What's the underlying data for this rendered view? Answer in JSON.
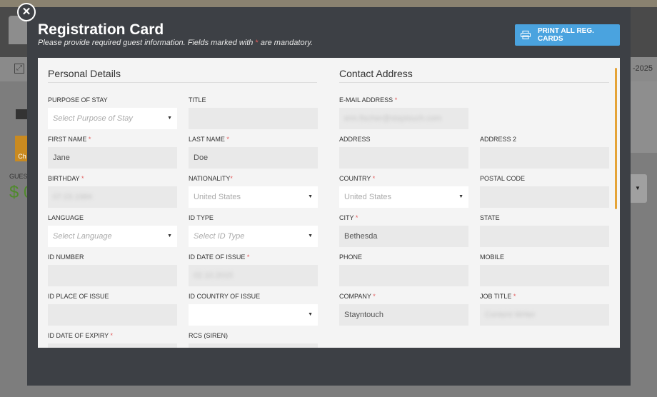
{
  "background": {
    "date_fragment": "-2025",
    "guest_label_fragment": "GUES",
    "balance_fragment": "$ 0",
    "orange_fragment": "Ch"
  },
  "modal": {
    "title": "Registration Card",
    "subtitle_before": "Please provide required guest information. Fields marked with ",
    "subtitle_star": "*",
    "subtitle_after": " are mandatory.",
    "print_button": "PRINT ALL REG. CARDS"
  },
  "personal": {
    "title": "Personal Details",
    "fields": {
      "purpose": {
        "label": "PURPOSE OF STAY",
        "placeholder": "Select Purpose of Stay"
      },
      "title": {
        "label": "TITLE",
        "value": ""
      },
      "first_name": {
        "label": "FIRST NAME",
        "value": "Jane"
      },
      "last_name": {
        "label": "LAST NAME",
        "value": "Doe"
      },
      "birthday": {
        "label": "BIRTHDAY",
        "value": "07.03.1984"
      },
      "nationality": {
        "label": "NATIONALITY",
        "value": "United States"
      },
      "language": {
        "label": "LANGUAGE",
        "placeholder": "Select Language"
      },
      "id_type": {
        "label": "ID TYPE",
        "placeholder": "Select ID Type"
      },
      "id_number": {
        "label": "ID NUMBER",
        "value": ""
      },
      "id_date_issue": {
        "label": "ID DATE OF ISSUE",
        "value": "02.10.2015"
      },
      "id_place_issue": {
        "label": "ID PLACE OF ISSUE",
        "value": ""
      },
      "id_country_issue": {
        "label": "ID COUNTRY OF ISSUE",
        "value": ""
      },
      "id_date_expiry": {
        "label": "ID DATE OF EXPIRY",
        "value": ""
      },
      "rcs": {
        "label": "RCS (SIREN)",
        "value": ""
      }
    }
  },
  "contact": {
    "title": "Contact Address",
    "fields": {
      "email": {
        "label": "E-MAIL ADDRESS",
        "value": "erin.fischer@staytouch.com"
      },
      "address": {
        "label": "ADDRESS",
        "value": ""
      },
      "address2": {
        "label": "ADDRESS 2",
        "value": ""
      },
      "country": {
        "label": "COUNTRY",
        "value": "United States"
      },
      "postal": {
        "label": "POSTAL CODE",
        "value": ""
      },
      "city": {
        "label": "CITY",
        "value": "Bethesda"
      },
      "state": {
        "label": "STATE",
        "value": ""
      },
      "phone": {
        "label": "PHONE",
        "value": ""
      },
      "mobile": {
        "label": "MOBILE",
        "value": ""
      },
      "company": {
        "label": "COMPANY",
        "value": "Stayntouch"
      },
      "job_title": {
        "label": "JOB TITLE",
        "value": "Content Writer"
      }
    }
  },
  "required_marker": "*",
  "icons": [
    "close-icon",
    "printer-icon",
    "caret-down-icon"
  ],
  "colors": {
    "accent": "#4aa3df",
    "required": "#e25b5b",
    "scrollbar": "#e5a336",
    "modal_bg": "#3d4045"
  }
}
